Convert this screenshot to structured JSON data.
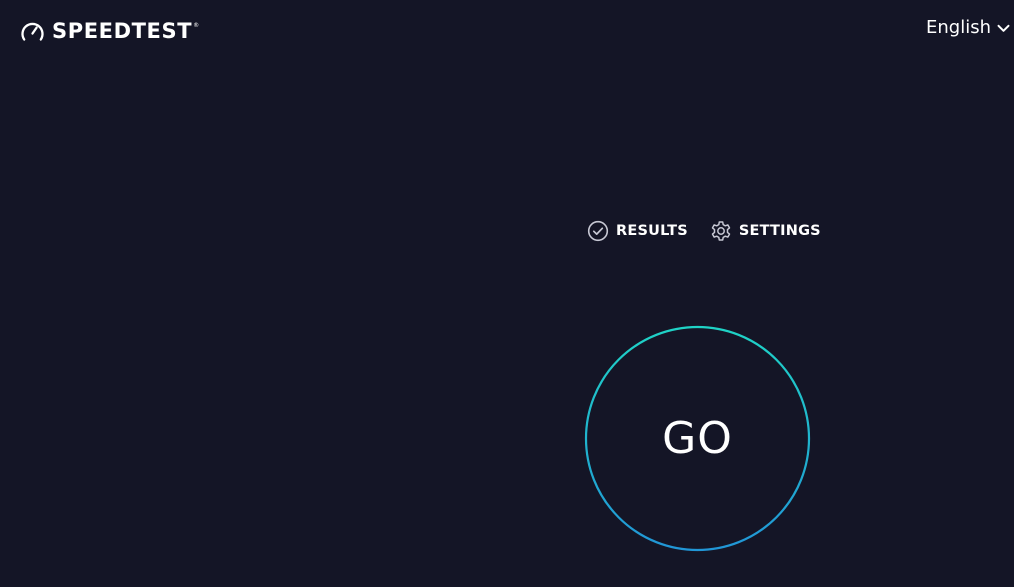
{
  "header": {
    "logo_text": "SPEEDTEST",
    "logo_trademark": "®",
    "logo_icon": "speedometer-icon",
    "language_label": "English",
    "language_icon": "chevron-down-icon"
  },
  "nav": {
    "results_label": "RESULTS",
    "results_icon": "check-circle-icon",
    "settings_label": "SETTINGS",
    "settings_icon": "gear-icon"
  },
  "main": {
    "go_label": "GO"
  },
  "colors": {
    "background": "#141526",
    "ring_start": "#1fd3c6",
    "ring_end": "#2196d6",
    "text": "#ffffff",
    "icon_muted": "#c7c8d4"
  }
}
